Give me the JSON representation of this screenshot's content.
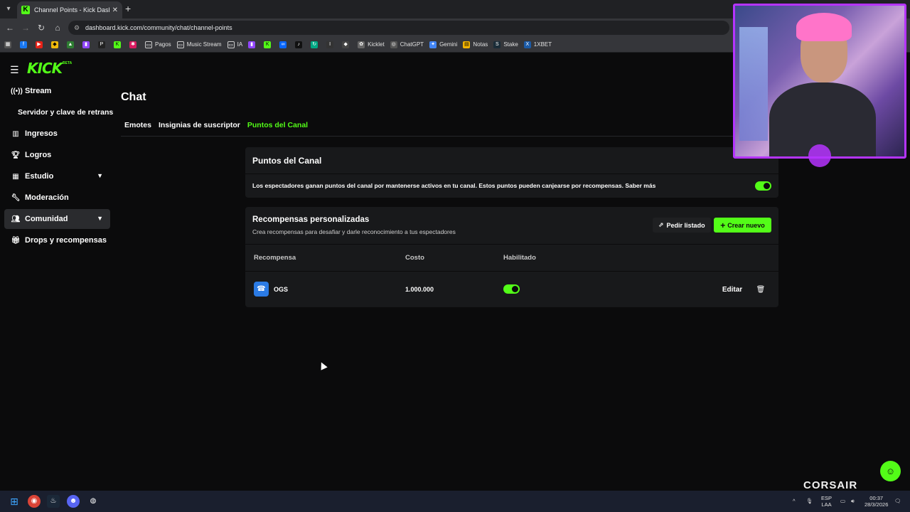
{
  "browser": {
    "tab_title": "Channel Points - Kick Dashboard",
    "url": "dashboard.kick.com/community/chat/channel-points",
    "bookmarks": [
      "Pagos",
      "Music Stream",
      "IA",
      "Kicklet",
      "ChatGPT",
      "Gemini",
      "Notas",
      "Stake",
      "1XBET"
    ]
  },
  "sidebar": {
    "logo": "KICK",
    "logo_badge": "BETA",
    "items": [
      {
        "label": "Stream",
        "icon": "broadcast-icon"
      },
      {
        "label": "Servidor y clave de retransmisión"
      },
      {
        "label": "Ingresos",
        "icon": "chart-icon"
      },
      {
        "label": "Logros",
        "icon": "trophy-icon"
      },
      {
        "label": "Estudio",
        "icon": "layout-icon"
      },
      {
        "label": "Moderación",
        "icon": "wrench-icon"
      },
      {
        "label": "Comunidad",
        "icon": "users-icon"
      },
      {
        "label": "Drops y recompensas",
        "icon": "gift-icon"
      }
    ]
  },
  "main": {
    "title": "Chat",
    "tabs": [
      {
        "label": "Emotes"
      },
      {
        "label": "Insignias de suscriptor"
      },
      {
        "label": "Puntos del Canal"
      }
    ]
  },
  "channel_points": {
    "title": "Puntos del Canal",
    "description": "Los espectadores ganan puntos del canal por mantenerse activos en tu canal. Estos puntos pueden canjearse por recompensas. Saber más",
    "enabled": true
  },
  "rewards": {
    "title": "Recompensas personalizadas",
    "subtitle": "Crea recompensas para desafiar y darle reconocimiento a tus espectadores",
    "list_button": "Pedir listado",
    "new_button": "Crear nuevo",
    "columns": [
      "Recompensa",
      "Costo",
      "Habilitado"
    ],
    "rows": [
      {
        "name": "OGS",
        "cost": "1.000.000",
        "enabled": true,
        "edit_label": "Editar"
      }
    ]
  },
  "overlay": {
    "brand": "CORSAIR"
  },
  "taskbar": {
    "lang": "ESP",
    "lang2": "LAA",
    "time": "00:37",
    "date": "28/3/2026"
  },
  "colors": {
    "accent": "#53fc18",
    "background": "#0b0b0c",
    "card": "#18191b",
    "webcam_border": "#b534ff"
  }
}
